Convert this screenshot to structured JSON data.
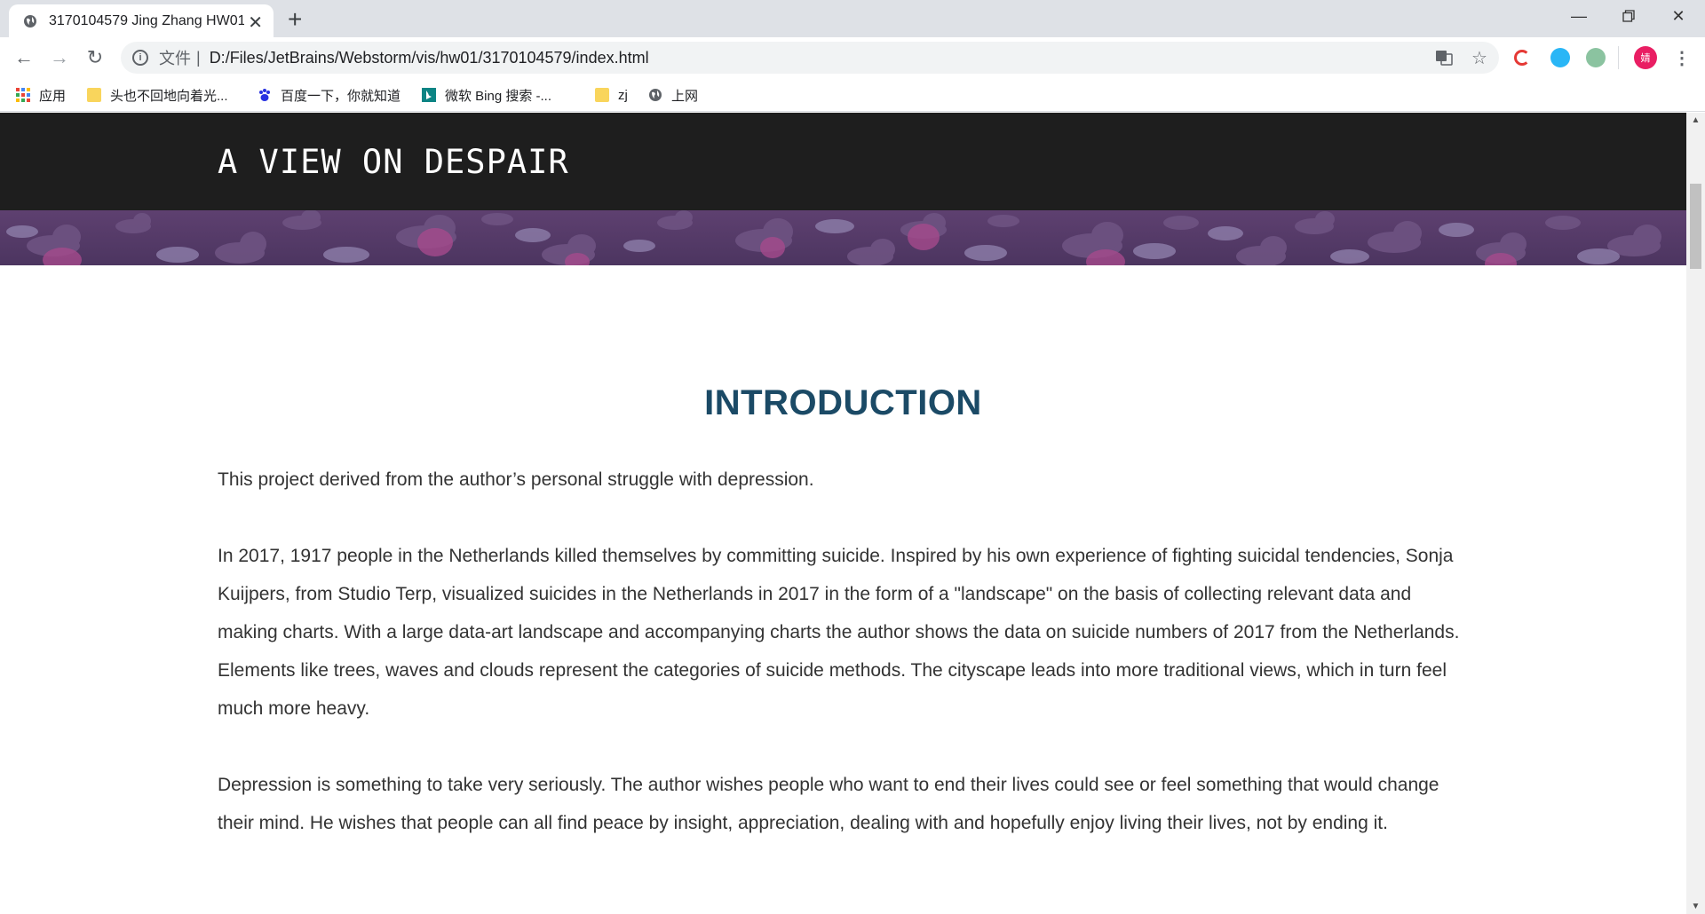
{
  "browser": {
    "tab_title": "3170104579 Jing Zhang HW01",
    "address_scheme": "文件",
    "address_separator": "|",
    "address_url": "D:/Files/JetBrains/Webstorm/vis/hw01/3170104579/index.html",
    "profile_initial": "婧",
    "bookmarks": [
      "应用",
      "头也不回地向着光...",
      "百度一下，你就知道",
      "微软 Bing 搜索 -...",
      "zj",
      "上网"
    ]
  },
  "page": {
    "site_title": "A VIEW ON DESPAIR",
    "intro_heading": "INTRODUCTION",
    "paragraphs": [
      "This project derived from the author’s personal struggle with depression.",
      "In 2017, 1917 people in the Netherlands killed themselves by committing suicide. Inspired by his own experience of fighting suicidal tendencies, Sonja Kuijpers, from Studio Terp, visualized suicides in the Netherlands in 2017 in the form of a \"landscape\" on the basis of collecting relevant data and making charts. With a large data-art landscape and accompanying charts the author shows the data on suicide numbers of 2017 from the Netherlands. Elements like trees, waves and clouds represent the categories of suicide methods. The cityscape leads into more traditional views, which in turn feel much more heavy.",
      "Depression is something to take very seriously. The author wishes people who want to end their lives could see or feel something that would change their mind. He wishes that people can all find peace by insight, appreciation, dealing with and hopefully enjoy living their lives, not by ending it."
    ]
  },
  "colors": {
    "header_bg": "#1e1e1e",
    "clouds_bg": "#563a68",
    "heading": "#1b4a66",
    "body_text": "#333333"
  }
}
